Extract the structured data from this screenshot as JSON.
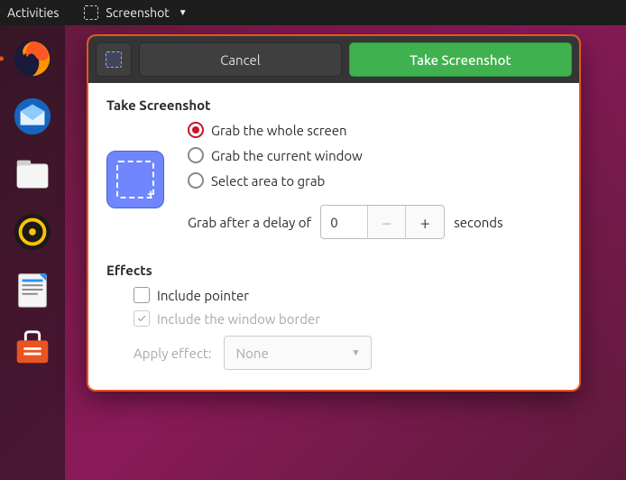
{
  "topbar": {
    "activities": "Activities",
    "app_name": "Screenshot"
  },
  "dock": {
    "items": [
      "firefox",
      "thunderbird",
      "files",
      "rhythmbox",
      "libreoffice-writer",
      "software"
    ]
  },
  "window": {
    "header": {
      "cancel": "Cancel",
      "take": "Take Screenshot"
    },
    "section_take": "Take Screenshot",
    "radios": {
      "whole": "Grab the whole screen",
      "window": "Grab the current window",
      "area": "Select area to grab",
      "selected": "whole"
    },
    "delay": {
      "label_before": "Grab after a delay of",
      "value": "0",
      "label_after": "seconds"
    },
    "section_effects": "Effects",
    "effects": {
      "include_pointer": {
        "label": "Include pointer",
        "checked": false
      },
      "include_border": {
        "label": "Include the window border",
        "checked": true,
        "disabled": true
      },
      "apply_label": "Apply effect:",
      "apply_value": "None",
      "apply_disabled": true
    }
  }
}
